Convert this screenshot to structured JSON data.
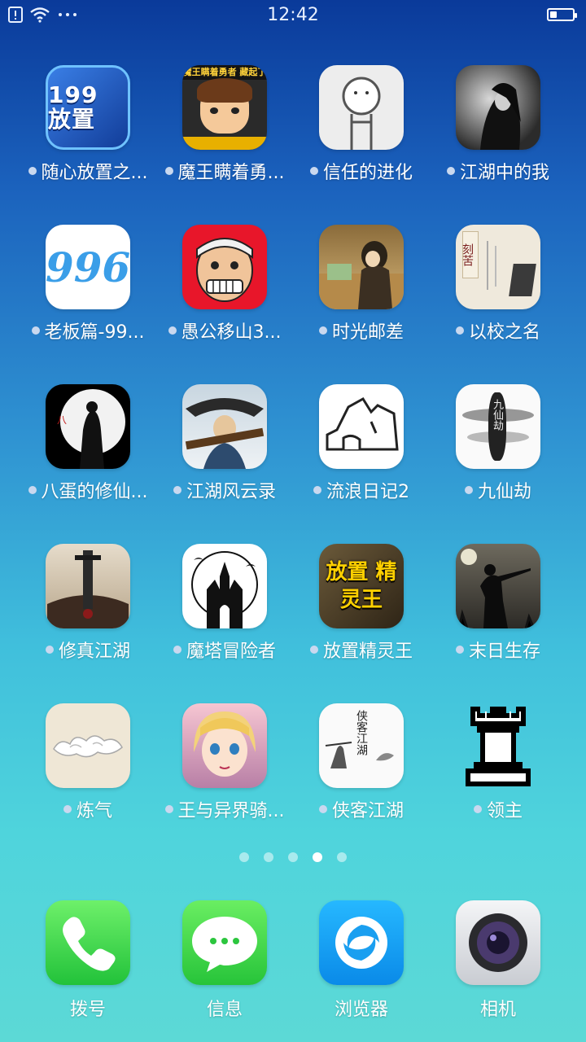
{
  "status_bar": {
    "time": "12:42",
    "battery_level": 0.3
  },
  "apps": [
    [
      {
        "label": "随心放置之...",
        "icon": "idle-199-icon",
        "icon_text": "199 放置"
      },
      {
        "label": "魔王瞒着勇...",
        "icon": "demon-king-icon",
        "icon_text": "魔王瞒着勇者 藏起了圣剑!"
      },
      {
        "label": "信任的进化",
        "icon": "trust-evolution-icon"
      },
      {
        "label": "江湖中的我",
        "icon": "jianghu-me-icon"
      }
    ],
    [
      {
        "label": "老板篇-99...",
        "icon": "boss-996-icon",
        "icon_text": "996"
      },
      {
        "label": "愚公移山3...",
        "icon": "yugong-icon"
      },
      {
        "label": "时光邮差",
        "icon": "time-postman-icon"
      },
      {
        "label": "以校之名",
        "icon": "school-name-icon",
        "icon_text": "刻苦"
      }
    ],
    [
      {
        "label": "八蛋的修仙...",
        "icon": "badan-cultivation-icon"
      },
      {
        "label": "江湖风云录",
        "icon": "jianghu-fengyun-icon"
      },
      {
        "label": "流浪日记2",
        "icon": "wander-diary-icon"
      },
      {
        "label": "九仙劫",
        "icon": "nine-immortals-icon",
        "icon_text": "九仙劫"
      }
    ],
    [
      {
        "label": "修真江湖",
        "icon": "xiuzhen-sword-icon"
      },
      {
        "label": "魔塔冒险者",
        "icon": "magic-tower-icon"
      },
      {
        "label": "放置精灵王",
        "icon": "idle-elf-king-icon",
        "icon_text": "放置 精灵王"
      },
      {
        "label": "末日生存",
        "icon": "doomsday-survival-icon"
      }
    ],
    [
      {
        "label": "炼气",
        "icon": "qi-clouds-icon"
      },
      {
        "label": "王与异界骑...",
        "icon": "king-knight-icon"
      },
      {
        "label": "侠客江湖",
        "icon": "xiake-jianghu-icon",
        "icon_text": "侠客江湖"
      },
      {
        "label": "领主",
        "icon": "lord-rook-icon"
      }
    ]
  ],
  "pager": {
    "count": 5,
    "active": 3
  },
  "dock": [
    {
      "label": "拨号",
      "icon": "phone-icon"
    },
    {
      "label": "信息",
      "icon": "messages-icon"
    },
    {
      "label": "浏览器",
      "icon": "browser-icon"
    },
    {
      "label": "相机",
      "icon": "camera-icon"
    }
  ],
  "colors": {
    "phone": "#3ddc4a",
    "messages": "#3fd64a",
    "browser": "#1a9ff0",
    "camera": "#d9dde3"
  }
}
